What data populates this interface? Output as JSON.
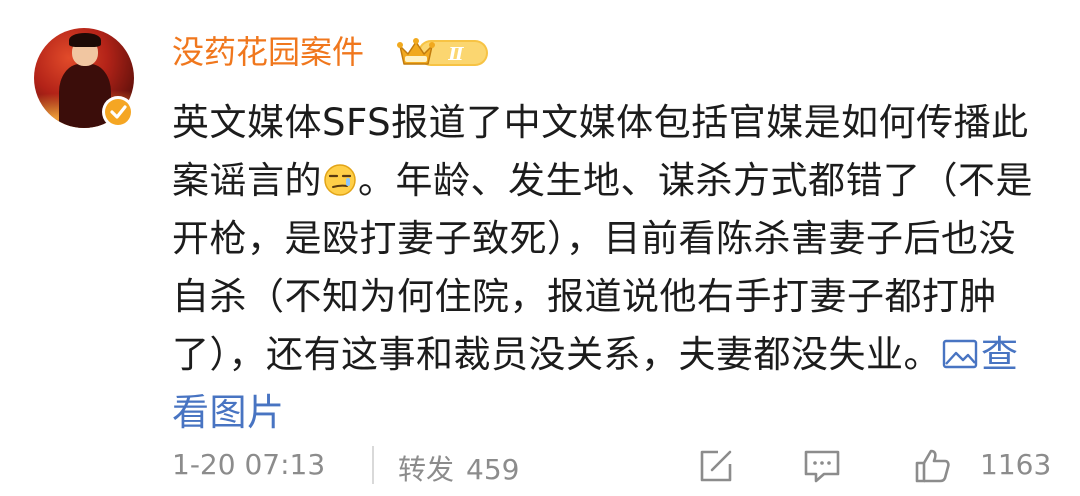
{
  "post": {
    "username": "没药花园案件",
    "vip_level": "Ⅱ",
    "text_part1": "英文媒体SFS报道了中文媒体包括官媒是如何传播此案谣言的",
    "emoji_name": "smirk-emoji",
    "text_part2": "。年龄、发生地、谋杀方式都错了（不是开枪，是殴打妻子致死），目前看陈杀害妻子后也没自杀（不知为何住院，报道说他右手打妻子都打肿了），还有这事和裁员没关系，夫妻都没失业。",
    "view_image_label": "查看图片"
  },
  "footer": {
    "timestamp": "1-20 07:13",
    "repost_label": "转发",
    "repost_count": "459",
    "like_count": "1163"
  },
  "colors": {
    "username": "#f0771d",
    "link": "#4874c2",
    "meta": "#8c8c8c",
    "text": "#1c1c1c"
  },
  "icons": {
    "share": "share-edit-icon",
    "comment": "comment-icon",
    "like": "thumbs-up-icon",
    "verified": "verified-badge-icon",
    "image": "image-icon"
  }
}
